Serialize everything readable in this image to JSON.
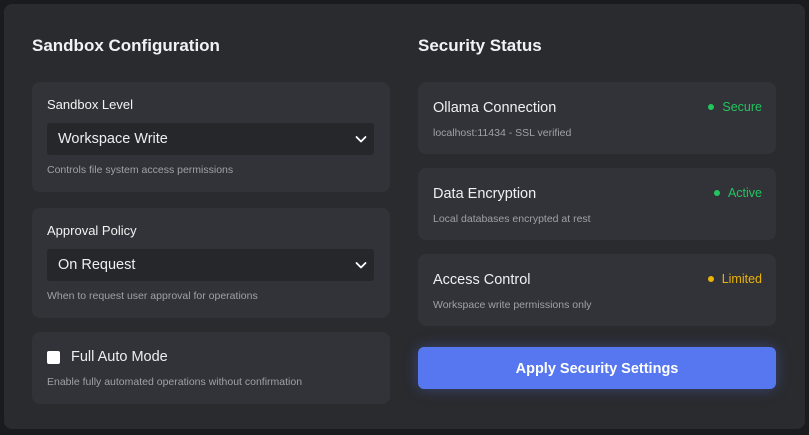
{
  "sandbox_config": {
    "title": "Sandbox Configuration",
    "sandbox_level": {
      "label": "Sandbox Level",
      "selected": "Workspace Write",
      "help": "Controls file system access permissions"
    },
    "approval_policy": {
      "label": "Approval Policy",
      "selected": "On Request",
      "help": "When to request user approval for operations"
    },
    "full_auto": {
      "label": "Full Auto Mode",
      "checked": false,
      "help": "Enable fully automated operations without confirmation"
    }
  },
  "security_status": {
    "title": "Security Status",
    "items": [
      {
        "name": "Ollama Connection",
        "detail": "localhost:11434 - SSL verified",
        "status": "Secure",
        "color": "#22c55e"
      },
      {
        "name": "Data Encryption",
        "detail": "Local databases encrypted at rest",
        "status": "Active",
        "color": "#22c55e"
      },
      {
        "name": "Access Control",
        "detail": "Workspace write permissions only",
        "status": "Limited",
        "color": "#eab308"
      }
    ],
    "apply_label": "Apply Security Settings"
  },
  "colors": {
    "background": "#1a1b1e",
    "panel": "#2a2b2f",
    "card": "#323338",
    "accent": "#5677f0",
    "secure": "#22c55e",
    "limited": "#eab308"
  },
  "icons": {
    "select_chevron": "chevron-down-icon",
    "status_dot": "status-dot-icon"
  }
}
